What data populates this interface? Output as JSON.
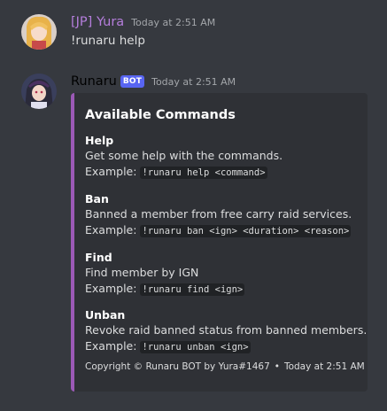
{
  "message1": {
    "username": "[JP] Yura",
    "username_color": "#b57edc",
    "timestamp": "Today at 2:51 AM",
    "content": "!runaru help"
  },
  "message2": {
    "username": "Runaru",
    "username_color": "#ffffff",
    "bot_tag": "BOT",
    "timestamp": "Today at 2:51 AM",
    "embed": {
      "accent_color": "#9b59b6",
      "title": "Available Commands",
      "fields": [
        {
          "name": "Help",
          "description": "Get some help with the commands.",
          "example_label": "Example:",
          "example_code": "!runaru help <command>"
        },
        {
          "name": "Ban",
          "description": "Banned a member from free carry raid services.",
          "example_label": "Example:",
          "example_code": "!runaru ban <ign> <duration> <reason>"
        },
        {
          "name": "Find",
          "description": "Find member by IGN",
          "example_label": "Example:",
          "example_code": "!runaru find <ign>"
        },
        {
          "name": "Unban",
          "description": "Revoke raid banned status from banned members.",
          "example_label": "Example:",
          "example_code": "!runaru unban <ign>"
        }
      ],
      "footer_text": "Copyright © Runaru BOT by Yura#1467",
      "footer_separator": "•",
      "footer_timestamp": "Today at 2:51 AM"
    }
  }
}
